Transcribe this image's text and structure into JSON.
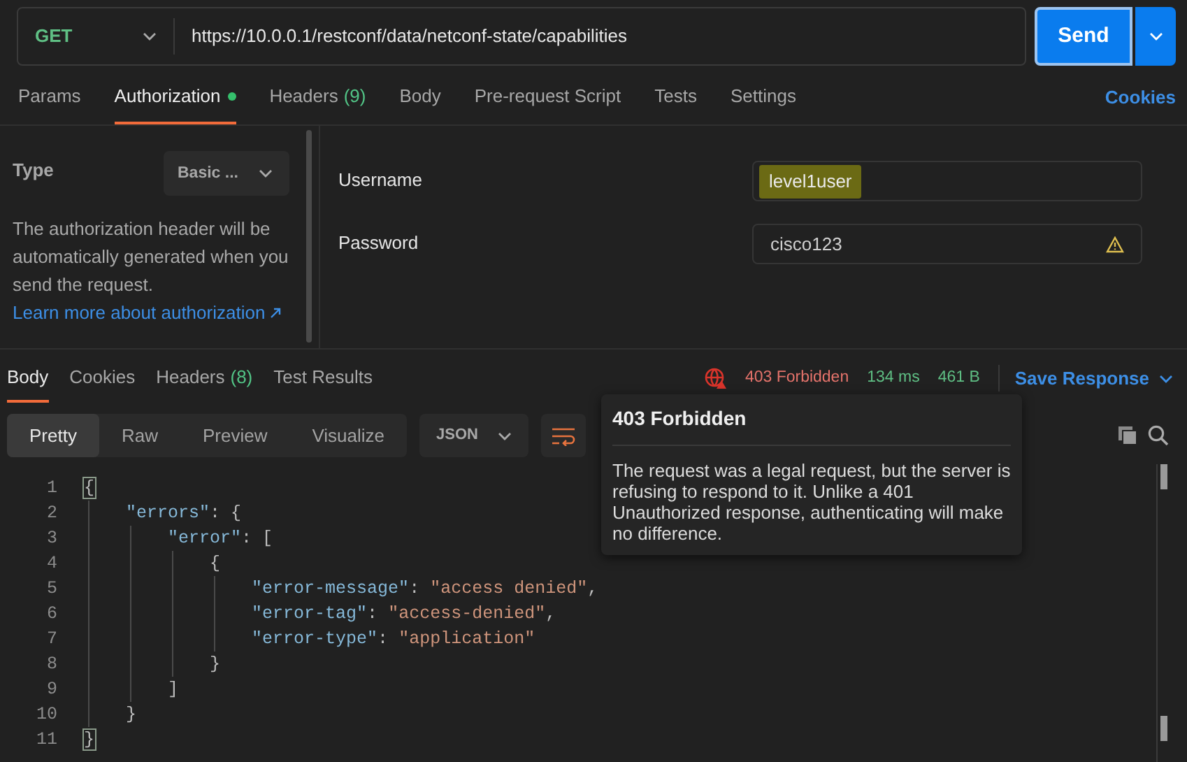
{
  "request": {
    "method": "GET",
    "url": "https://10.0.0.1/restconf/data/netconf-state/capabilities",
    "send": "Send"
  },
  "request_tabs": [
    {
      "label": "Params",
      "selected": false
    },
    {
      "label": "Authorization",
      "selected": true,
      "dot": true
    },
    {
      "label": "Headers",
      "count": "(9)",
      "selected": false
    },
    {
      "label": "Body",
      "selected": false
    },
    {
      "label": "Pre-request Script",
      "selected": false
    },
    {
      "label": "Tests",
      "selected": false
    },
    {
      "label": "Settings",
      "selected": false
    }
  ],
  "cookies_link": "Cookies",
  "auth": {
    "type_label": "Type",
    "type_value": "Basic ...",
    "description": "The authorization header will be automatically generated when you send the request.",
    "learn_more": "Learn more about authorization",
    "fields": [
      {
        "label": "Username",
        "value": "level1user",
        "highlighted": true,
        "warning": false
      },
      {
        "label": "Password",
        "value": "cisco123",
        "highlighted": false,
        "warning": true
      }
    ]
  },
  "response_tabs": [
    {
      "label": "Body",
      "selected": true
    },
    {
      "label": "Cookies",
      "selected": false
    },
    {
      "label": "Headers",
      "count": "(8)",
      "selected": false
    },
    {
      "label": "Test Results",
      "selected": false
    }
  ],
  "status": {
    "code": "403 Forbidden",
    "time": "134 ms",
    "size": "461 B",
    "save": "Save Response"
  },
  "view_modes": [
    {
      "label": "Pretty",
      "selected": true
    },
    {
      "label": "Raw",
      "selected": false
    },
    {
      "label": "Preview",
      "selected": false
    },
    {
      "label": "Visualize",
      "selected": false
    }
  ],
  "format": "JSON",
  "code_lines": [
    {
      "number": "1",
      "text": "{",
      "matched_bracket": true
    },
    {
      "number": "2",
      "text": "    \"errors\": {",
      "matched_bracket": false
    },
    {
      "number": "3",
      "text": "        \"error\": [",
      "matched_bracket": false
    },
    {
      "number": "4",
      "text": "            {",
      "matched_bracket": false
    },
    {
      "number": "5",
      "text": "                \"error-message\": \"access denied\",",
      "matched_bracket": false
    },
    {
      "number": "6",
      "text": "                \"error-tag\": \"access-denied\",",
      "matched_bracket": false
    },
    {
      "number": "7",
      "text": "                \"error-type\": \"application\"",
      "matched_bracket": false
    },
    {
      "number": "8",
      "text": "            }",
      "matched_bracket": false
    },
    {
      "number": "9",
      "text": "        ]",
      "matched_bracket": false
    },
    {
      "number": "10",
      "text": "    }",
      "matched_bracket": false
    },
    {
      "number": "11",
      "text": "}",
      "matched_bracket": true
    }
  ],
  "tooltip": {
    "title": "403 Forbidden",
    "text": "The request was a legal request, but the server is refusing to respond to it. Unlike a 401 Unauthorized response, authenticating will make no difference."
  }
}
